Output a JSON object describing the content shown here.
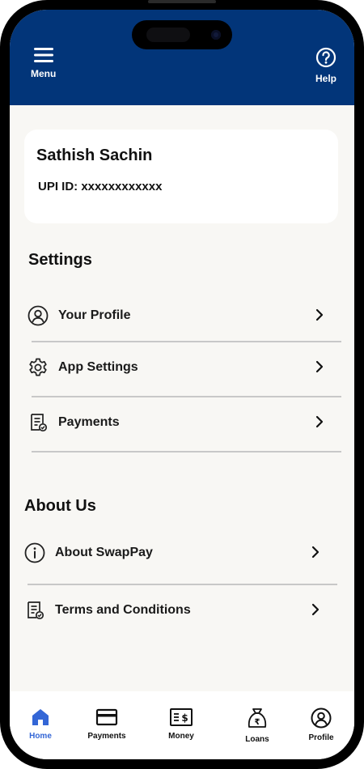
{
  "header": {
    "menu_label": "Menu",
    "help_label": "Help",
    "color": "#023579"
  },
  "profile": {
    "name": "Sathish Sachin",
    "upi": "UPI ID: xxxxxxxxxxxx"
  },
  "settings": {
    "title": "Settings",
    "items": [
      {
        "label": "Your Profile",
        "icon": "user-circle-icon"
      },
      {
        "label": "App Settings",
        "icon": "gear-icon"
      },
      {
        "label": "Payments",
        "icon": "receipt-icon"
      }
    ]
  },
  "about": {
    "title": "About Us",
    "items": [
      {
        "label": "About SwapPay",
        "icon": "info-icon"
      },
      {
        "label": "Terms and Conditions",
        "icon": "receipt-icon"
      }
    ]
  },
  "tabbar": {
    "active": "Home",
    "active_color": "#3366d6",
    "tabs": [
      {
        "label": "Home",
        "icon": "home-icon"
      },
      {
        "label": "Payments",
        "icon": "card-icon"
      },
      {
        "label": "Money",
        "icon": "money-icon"
      },
      {
        "label": "Loans",
        "icon": "money-bag-icon"
      },
      {
        "label": "Profile",
        "icon": "user-circle-icon"
      }
    ]
  }
}
